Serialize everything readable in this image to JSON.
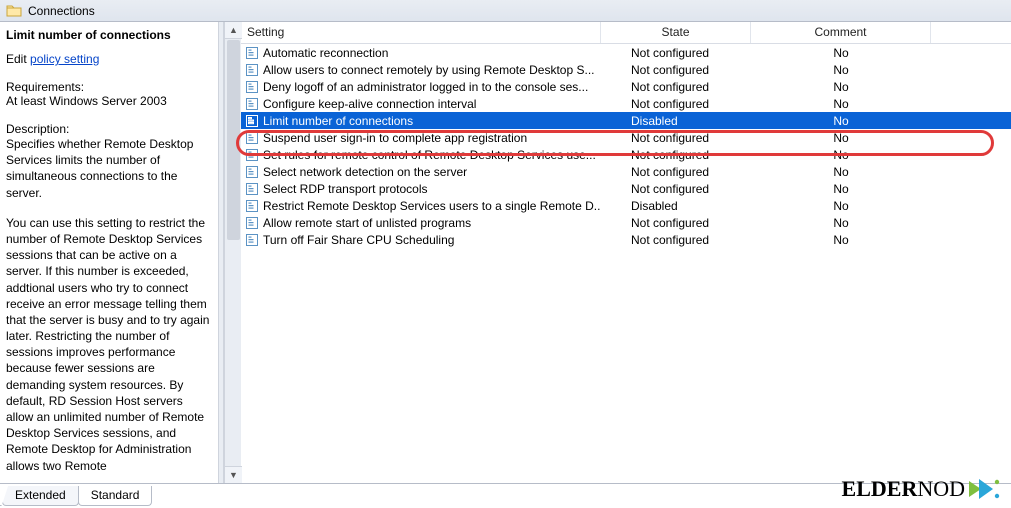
{
  "window": {
    "title": "Connections"
  },
  "left": {
    "policy_title": "Limit number of connections",
    "edit_prefix": "Edit ",
    "edit_link": "policy setting ",
    "req_heading": "Requirements:",
    "req_value": "At least Windows Server 2003",
    "desc_heading": "Description:",
    "desc_p1": "Specifies whether Remote Desktop Services limits the number of simultaneous connections to the server.",
    "desc_p2": "You can use this setting to restrict the number of Remote Desktop Services sessions that can be active on a server. If this number is exceeded, addtional users who try to connect receive an error message telling them that the server is busy and to try again later. Restricting the number of sessions improves performance because fewer sessions are demanding system resources. By default, RD Session Host servers allow an unlimited number of Remote Desktop Services sessions, and Remote Desktop for Administration allows two Remote"
  },
  "headers": {
    "setting": "Setting",
    "state": "State",
    "comment": "Comment"
  },
  "rows": [
    {
      "setting": "Automatic reconnection",
      "state": "Not configured",
      "comment": "No",
      "selected": false
    },
    {
      "setting": "Allow users to connect remotely by using Remote Desktop S...",
      "state": "Not configured",
      "comment": "No",
      "selected": false
    },
    {
      "setting": "Deny logoff of an administrator logged in to the console ses...",
      "state": "Not configured",
      "comment": "No",
      "selected": false
    },
    {
      "setting": "Configure keep-alive connection interval",
      "state": "Not configured",
      "comment": "No",
      "selected": false
    },
    {
      "setting": "Limit number of connections",
      "state": "Disabled",
      "comment": "No",
      "selected": true
    },
    {
      "setting": "Suspend user sign-in to complete app registration",
      "state": "Not configured",
      "comment": "No",
      "selected": false
    },
    {
      "setting": "Set rules for remote control of Remote Desktop Services use...",
      "state": "Not configured",
      "comment": "No",
      "selected": false
    },
    {
      "setting": "Select network detection on the server",
      "state": "Not configured",
      "comment": "No",
      "selected": false
    },
    {
      "setting": "Select RDP transport protocols",
      "state": "Not configured",
      "comment": "No",
      "selected": false
    },
    {
      "setting": "Restrict Remote Desktop Services users to a single Remote D...",
      "state": "Disabled",
      "comment": "No",
      "selected": false
    },
    {
      "setting": "Allow remote start of unlisted programs",
      "state": "Not configured",
      "comment": "No",
      "selected": false
    },
    {
      "setting": "Turn off Fair Share CPU Scheduling",
      "state": "Not configured",
      "comment": "No",
      "selected": false
    }
  ],
  "tabs": {
    "extended": "Extended",
    "standard": "Standard"
  },
  "logo": {
    "text_bold": "ELDER",
    "text_rest": "NOD"
  }
}
